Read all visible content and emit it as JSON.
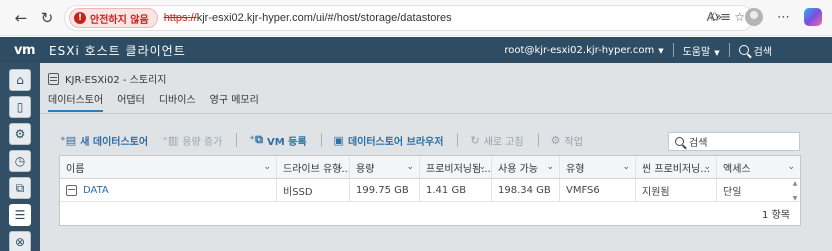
{
  "browser": {
    "insecure_label": "안전하지 않음",
    "url_scheme": "https://",
    "url_rest": "kjr-esxi02.kjr-hyper.com/ui/#/host/storage/datastores"
  },
  "header": {
    "logo": "vm",
    "title": "ESXi 호스트 클라이언트",
    "user": "root@kjr-esxi02.kjr-hyper.com",
    "help": "도움말",
    "search": "검색"
  },
  "page": {
    "title": "KJR-ESXi02 - 스토리지",
    "tabs": [
      "데이터스토어",
      "어댑터",
      "디바이스",
      "영구 메모리"
    ],
    "active_tab": 0
  },
  "toolbar": {
    "new_datastore": "새 데이터스토어",
    "increase_capacity": "용량 증가",
    "register_vm": "VM 등록",
    "datastore_browser": "데이터스토어 브라우저",
    "refresh": "새로 고침",
    "actions": "작업",
    "search_placeholder": "검색"
  },
  "table": {
    "columns": [
      "이름",
      "드라이브 유형...",
      "용량",
      "프로비저닝됨...",
      "사용 가능",
      "유형",
      "씬 프로비저닝...",
      "액세스"
    ],
    "rows": [
      {
        "name": "DATA",
        "drive_type": "비SSD",
        "capacity": "199.75 GB",
        "provisioned": "1.41 GB",
        "free": "198.34 GB",
        "type": "VMFS6",
        "thin": "지원됨",
        "access": "단일"
      }
    ],
    "footer": "1 항목"
  }
}
